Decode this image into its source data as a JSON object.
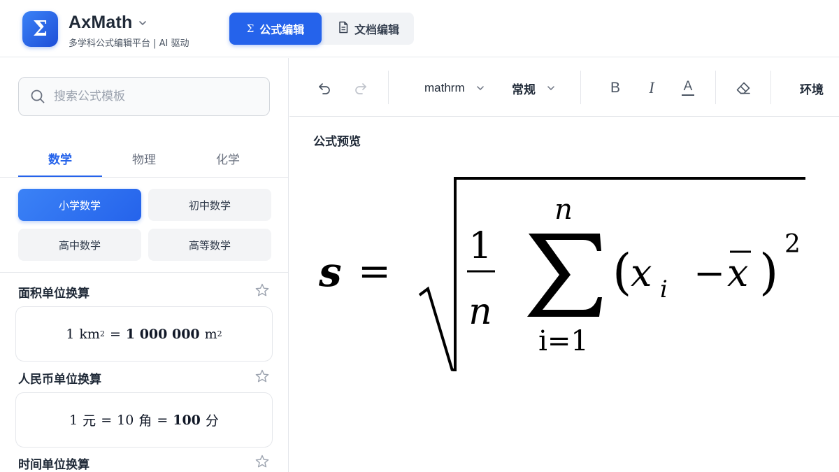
{
  "app": {
    "logo_glyph": "Σ",
    "name": "AxMath",
    "subtitle": "多学科公式编辑平台 | AI 驱动",
    "accent_color": "#2563eb"
  },
  "modes": [
    {
      "label": "公式编辑",
      "icon": "sigma-icon",
      "active": true
    },
    {
      "label": "文档编辑",
      "icon": "document-icon",
      "active": false
    }
  ],
  "sidebar": {
    "search": {
      "placeholder": "搜索公式模板",
      "value": ""
    },
    "subject_tabs": [
      {
        "label": "数学",
        "active": true
      },
      {
        "label": "物理",
        "active": false
      },
      {
        "label": "化学",
        "active": false
      }
    ],
    "levels": [
      {
        "label": "小学数学",
        "active": true
      },
      {
        "label": "初中数学",
        "active": false
      },
      {
        "label": "高中数学",
        "active": false
      },
      {
        "label": "高等数学",
        "active": false
      }
    ],
    "templates": [
      {
        "title": "面积单位换算",
        "formula": {
          "a": "1",
          "u1": "km",
          "exp1": "2",
          "eq": "=",
          "b": "1 000 000",
          "u2": "m",
          "exp2": "2"
        }
      },
      {
        "title": "人民币单位换算",
        "formula": {
          "a": "1",
          "u1": "元",
          "eq1": "=",
          "b": "10",
          "u2": "角",
          "eq2": "=",
          "c": "100",
          "u3": "分"
        }
      },
      {
        "title": "时间单位换算"
      }
    ]
  },
  "toolbar": {
    "undo_icon": "undo-icon",
    "redo_icon": "redo-icon",
    "font_style": "mathrm",
    "size": "常规",
    "bold_label": "B",
    "italic_label": "I",
    "color_label": "A",
    "eraser_icon": "eraser-icon",
    "environment": "环境"
  },
  "preview": {
    "title": "公式预览",
    "formula": {
      "lhs": "s",
      "eq": "=",
      "frac_num": "1",
      "frac_den": "n",
      "sum_upper": "n",
      "sum_lower": "i=1",
      "lparen": "(",
      "x": "x",
      "sub_i": "i",
      "minus": "−",
      "xbar": "x",
      "rparen": ")",
      "power": "2"
    }
  }
}
